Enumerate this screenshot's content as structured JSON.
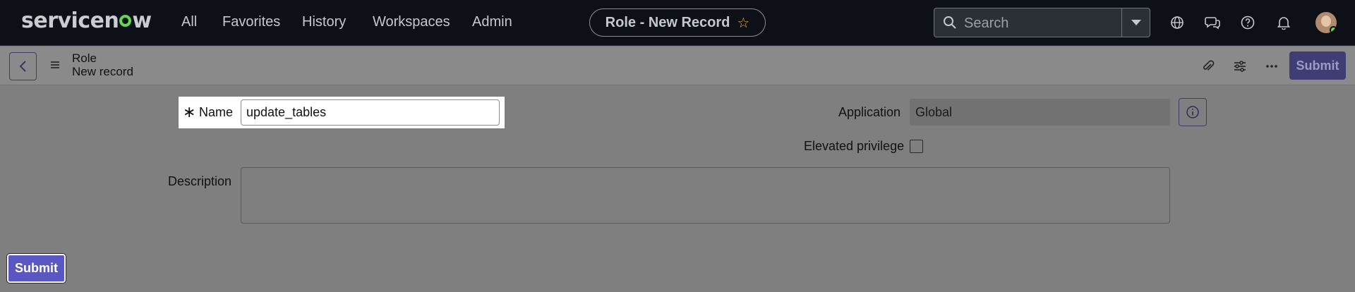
{
  "app": {
    "logo_text_a": "servicen",
    "logo_text_b": "w"
  },
  "nav": {
    "all": "All",
    "favorites": "Favorites",
    "history": "History",
    "workspaces": "Workspaces",
    "admin": "Admin"
  },
  "title_pill": {
    "label": "Role - New Record",
    "star_icon": "star-icon"
  },
  "search": {
    "placeholder": "Search"
  },
  "topbar_icons": [
    "globe-icon",
    "chat-icon",
    "help-icon",
    "bell-icon",
    "avatar"
  ],
  "record": {
    "table": "Role",
    "state": "New record"
  },
  "header_actions": [
    "paperclip-icon",
    "sliders-icon",
    "more-icon"
  ],
  "buttons": {
    "submit_top": "Submit",
    "submit_bottom": "Submit"
  },
  "form": {
    "name_label": "Name",
    "name_required_mark": "∗",
    "name_value": "update_tables",
    "application_label": "Application",
    "application_value": "Global",
    "elevated_label": "Elevated privilege",
    "description_label": "Description"
  },
  "colors": {
    "accent": "#5a57c2",
    "nav_bg": "#0d1016",
    "logo_green": "#62d84e"
  }
}
